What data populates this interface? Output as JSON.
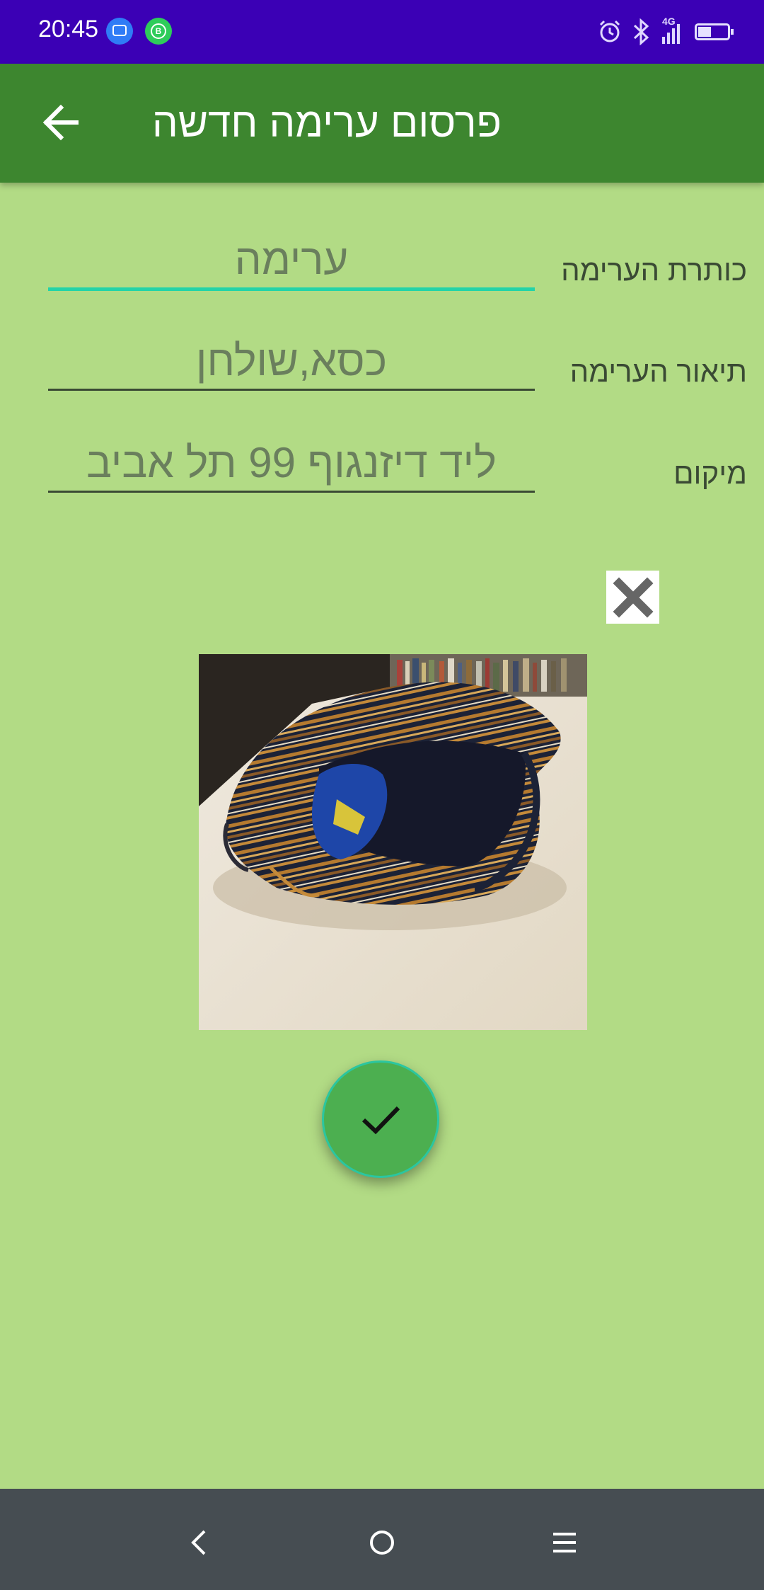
{
  "status_bar": {
    "time": "20:45",
    "notification_icons": [
      "messages-icon",
      "whatsapp-business-icon"
    ],
    "right_icons": [
      "alarm-icon",
      "bluetooth-icon",
      "signal-4g-icon",
      "battery-icon"
    ],
    "network_label": "4G",
    "battery_level": 0.45
  },
  "app_bar": {
    "title": "פרסום ערימה חדשה",
    "back_icon": "arrow-back-icon"
  },
  "form": {
    "title_label": "כותרת הערימה",
    "title_value": "ערימה",
    "description_label": "תיאור הערימה",
    "description_value": "כסא,שולחן",
    "location_label": "מיקום",
    "location_value": "ליד דיזנגוף 99 תל אביב"
  },
  "image": {
    "remove_icon": "close-icon"
  },
  "submit": {
    "icon": "check-icon"
  },
  "nav_bar": {
    "buttons": [
      "back-icon",
      "home-icon",
      "menu-icon"
    ]
  },
  "colors": {
    "status_bar": "#3b00b5",
    "app_bar": "#3d862f",
    "background": "#b2db85",
    "accent_underline": "#23d3a8",
    "fab": "#4caf50",
    "nav_bar": "#464d52"
  }
}
